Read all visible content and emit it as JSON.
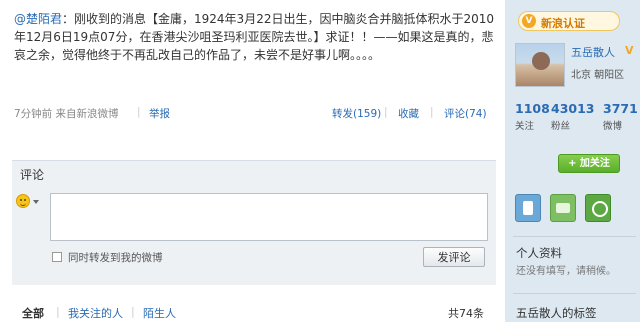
{
  "post": {
    "author": "@楚陌君",
    "text": "：刚收到的消息【金庸，1924年3月22日出生，因中脑炎合并脑抵体积水于2010年12月6日19点07分，在香港尖沙咀圣玛利亚医院去世。】求证！！——如果这是真的，悲哀之余，觉得他终于不再乱改自己的作品了，未尝不是好事儿啊。。。。"
  },
  "meta": {
    "source": "7分钟前 来自新浪微博",
    "report": "举报",
    "forward": "转发(159)",
    "favorite": "收藏",
    "comment": "评论(74)"
  },
  "comment_box": {
    "title": "评论",
    "textarea_value": "",
    "also_forward_label": "同时转发到我的微博",
    "submit_label": "发评论"
  },
  "filter": {
    "tabs": [
      "全部",
      "我关注的人",
      "陌生人"
    ],
    "total": "共74条"
  },
  "sidebar": {
    "badge_icon": "V",
    "badge_label": "新浪认证",
    "user_name": "五岳散人",
    "verified_mark": "V",
    "location": "北京  朝阳区",
    "stats": [
      {
        "num": "1108",
        "label": "关注"
      },
      {
        "num": "43013",
        "label": "粉丝"
      },
      {
        "num": "3771",
        "label": "微博"
      }
    ],
    "follow_button": "+ 加关注",
    "profile_title": "个人资料",
    "profile_sub": "还没有填写，请稍候。",
    "tags_title": "五岳散人的标签"
  },
  "colors": {
    "link": "#2a6bb4",
    "sidebar_bg": "#dde8f0",
    "follow_green": "#5aae2c",
    "badge_orange": "#f5a623"
  },
  "icons": [
    "smiley-icon",
    "phone-icon",
    "desktop-icon",
    "twitter-icon"
  ]
}
